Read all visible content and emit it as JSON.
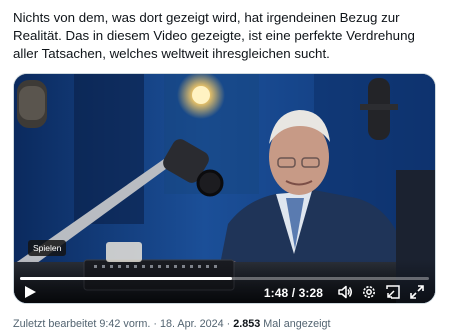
{
  "tweet": {
    "text": "Nichts von dem, was dort gezeigt wird, hat irgendeinen Bezug zur Realität. Das in diesem Video gezeigte, ist eine perfekte Verdrehung aller Tatsachen, welches weltweit ihresgleichen sucht."
  },
  "video": {
    "tooltip": "Spielen",
    "time_display": "1:48 / 3:28",
    "progress_fraction": 0.519,
    "icons": {
      "play": "play-icon",
      "volume": "volume-icon",
      "settings": "settings-icon",
      "pip": "picture-in-picture-icon",
      "fullscreen": "fullscreen-icon"
    }
  },
  "meta": {
    "edited_text": "Zuletzt bearbeitet 9:42 vorm. · 18. Apr. 2024 · ",
    "views_count": "2.853",
    "views_label": " Mal angezeigt"
  },
  "colors": {
    "text_primary": "#0f1419",
    "text_secondary": "#536471",
    "studio_blue": "#123a7a"
  }
}
